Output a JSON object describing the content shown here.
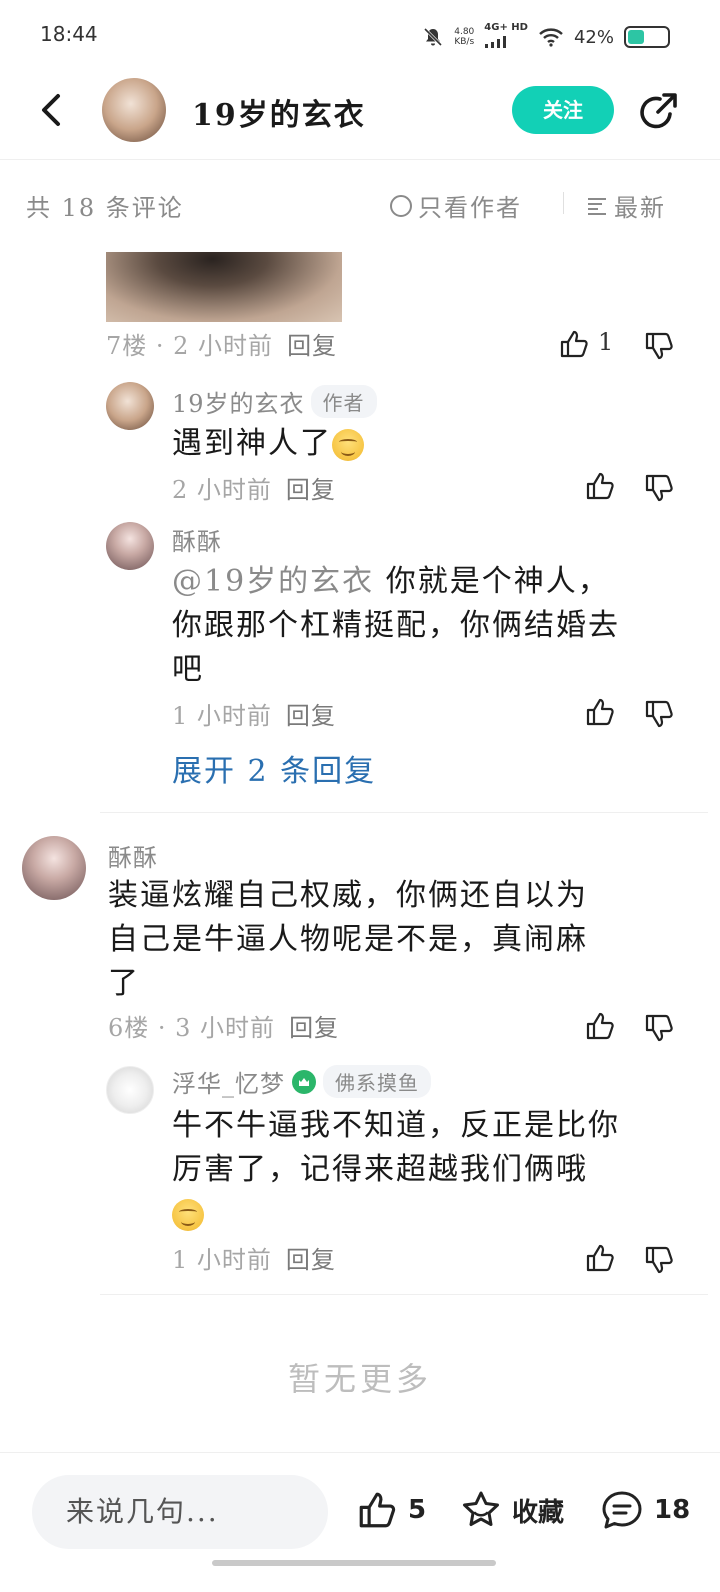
{
  "status_bar": {
    "time": "18:44",
    "speed_value": "4.80",
    "speed_unit": "KB/s",
    "network": "4G+ HD",
    "battery": "42%"
  },
  "header": {
    "title": "19岁的玄衣",
    "follow_label": "关注"
  },
  "sort_bar": {
    "count": "共 18 条评论",
    "only_author": "只看作者",
    "sort": "最新"
  },
  "comments": [
    {
      "meta": "7楼 · 2 小时前",
      "reply_label": "回复",
      "likes": "1",
      "replies": [
        {
          "user": "19岁的玄衣",
          "tag": "作者",
          "text": "遇到神人了",
          "meta": "2 小时前",
          "reply_label": "回复"
        },
        {
          "user": "酥酥",
          "mention": "@19岁的玄衣",
          "text_line1": "你就是个神人，",
          "text_line2": "你跟那个杠精挺配，你俩结婚去",
          "text_line3": "吧",
          "meta": "1 小时前",
          "reply_label": "回复"
        }
      ],
      "expand_label": "展开 2 条回复"
    },
    {
      "user": "酥酥",
      "text_line1": "装逼炫耀自己权威，你俩还自以为",
      "text_line2": "自己是牛逼人物呢是不是，真闹麻",
      "text_line3": "了",
      "meta": "6楼 · 3 小时前",
      "reply_label": "回复",
      "replies": [
        {
          "user": "浮华_忆梦",
          "tag": "佛系摸鱼",
          "text_line1": "牛不牛逼我不知道，反正是比你",
          "text_line2": "厉害了，记得来超越我们俩哦",
          "meta": "1 小时前",
          "reply_label": "回复"
        }
      ]
    }
  ],
  "no_more": "暂无更多",
  "bottom_bar": {
    "input_placeholder": "来说几句...",
    "likes": "5",
    "favorite_label": "收藏",
    "comments": "18"
  },
  "colors": {
    "accent": "#12d0b6",
    "link": "#2a6fb0",
    "muted": "#8a8a8a"
  }
}
